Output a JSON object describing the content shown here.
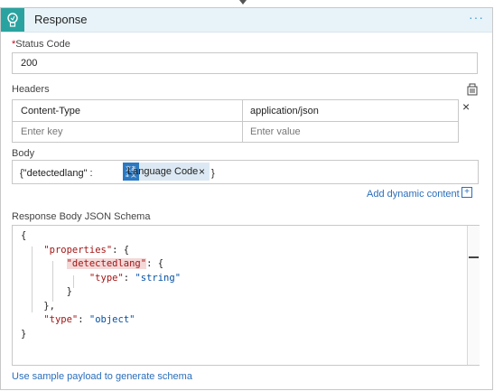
{
  "action": {
    "title": "Response",
    "more_label": "···"
  },
  "status_code": {
    "required_mark": "*",
    "label": "Status Code",
    "value": "200"
  },
  "headers": {
    "label": "Headers",
    "rows": [
      {
        "key": "Content-Type",
        "value": "application/json"
      }
    ],
    "key_placeholder": "Enter key",
    "value_placeholder": "Enter value",
    "delete_glyph": "×"
  },
  "body": {
    "label": "Body",
    "prefix": "{\"detectedlang\" :",
    "token": {
      "label": "Language Code",
      "remove": "×"
    },
    "suffix": "}",
    "dynamic_link": "Add dynamic content",
    "dynamic_plus": "+"
  },
  "schema": {
    "label": "Response Body JSON Schema",
    "lines": {
      "l1": "{",
      "l2_key": "\"properties\"",
      "l2_rest": ": {",
      "l3_key": "\"detectedlang\"",
      "l3_rest": ": {",
      "l4_key": "\"type\"",
      "l4_colon": ": ",
      "l4_val": "\"string\"",
      "l5": "}",
      "l6": "},",
      "l7_key": "\"type\"",
      "l7_colon": ": ",
      "l7_val": "\"object\"",
      "l8": "}"
    },
    "sample_link": "Use sample payload to generate schema"
  },
  "colors": {
    "accent": "#2aa3a0",
    "header_bg": "#e8f3f9",
    "link": "#2a6ebb",
    "json_key": "#a31515",
    "json_string": "#0451a5",
    "token_bg": "#dce9f4"
  },
  "icons": {
    "action": "response-bulb-icon",
    "headers_toolbar": "switch-to-text-mode-icon",
    "token": "translator-icon"
  }
}
